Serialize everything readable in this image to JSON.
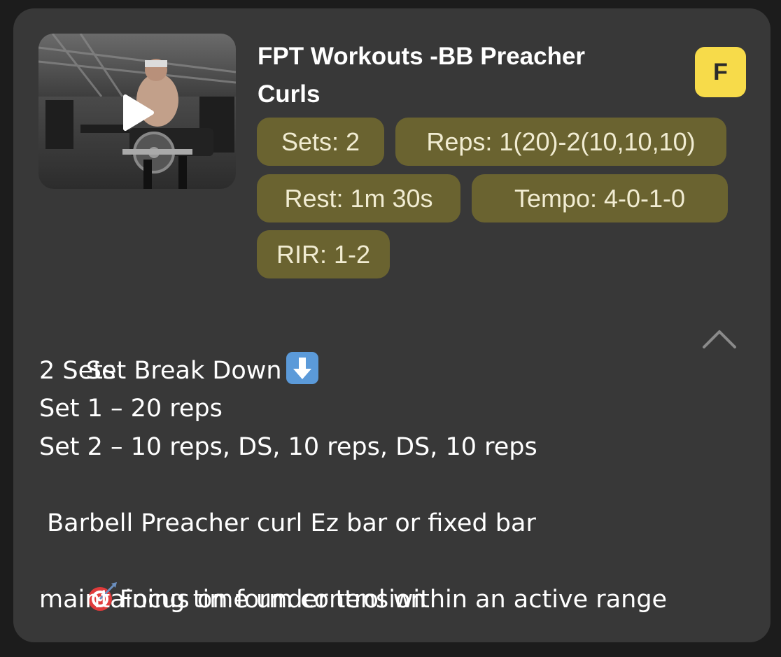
{
  "workout": {
    "title": "FPT Workouts -BB Preacher Curls",
    "badge_letter": "F",
    "video_thumbnail": "play-icon"
  },
  "chips": [
    "Sets: 2",
    "Reps: 1(20)-2(10,10,10)",
    "Rest: 1m 30s",
    "Tempo: 4-0-1-0",
    "RIR: 1-2"
  ],
  "description": {
    "line1": "Set Break Down",
    "line1_icon": "down-arrow-emoji-icon",
    "line2": "2 Sets",
    "line3": "Set 1 – 20 reps",
    "line4": "Set 2 – 10 reps, DS, 10 reps, DS, 10 reps",
    "line5": "",
    "line6": " Barbell Preacher curl Ez bar or fixed bar",
    "line7_icon": "direct-hit-target-icon",
    "line7": "Focus on form control within an active range",
    "line8": "maintaining time under tension"
  },
  "colors": {
    "card": "#383838",
    "chip": "#6a6330",
    "badge": "#f7db4a"
  },
  "collapse_icon": "chevron-up-icon"
}
